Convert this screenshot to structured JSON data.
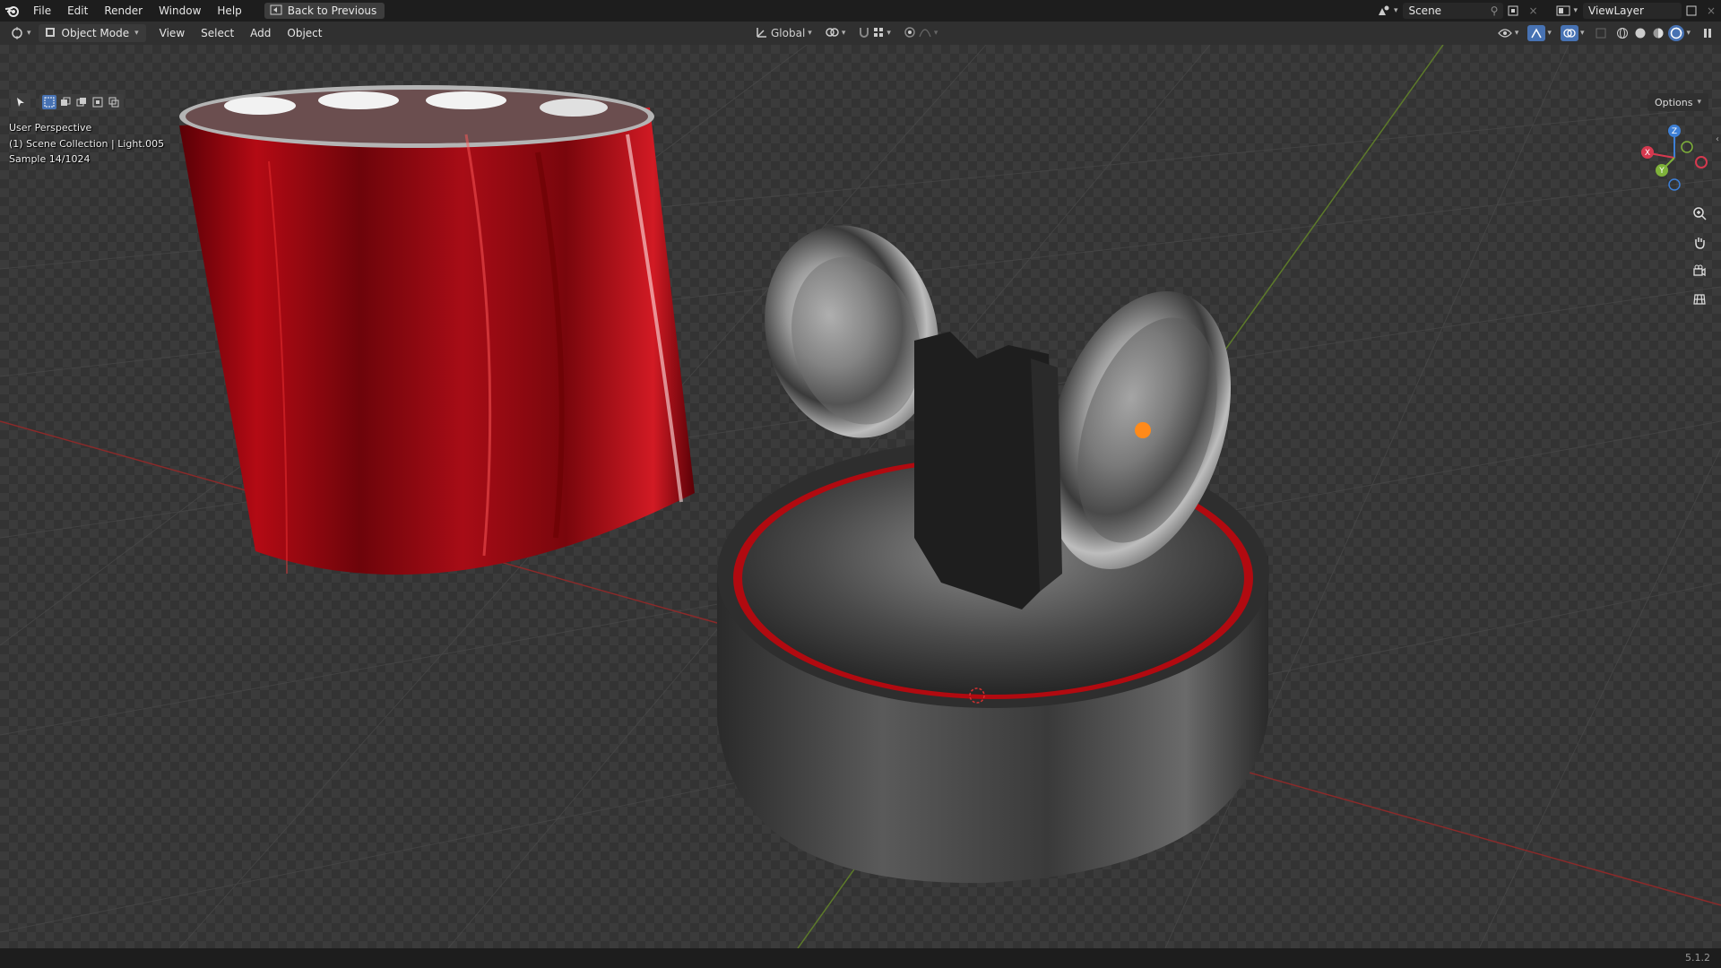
{
  "topbar": {
    "menus": [
      "File",
      "Edit",
      "Render",
      "Window",
      "Help"
    ],
    "back_button": "Back to Previous",
    "scene_name": "Scene",
    "view_layer_name": "ViewLayer"
  },
  "header": {
    "mode": "Object Mode",
    "menus": [
      "View",
      "Select",
      "Add",
      "Object"
    ],
    "transform_orientation": "Global",
    "options": "Options"
  },
  "viewport": {
    "perspective": "User Perspective",
    "collection": "(1) Scene Collection | Light.005",
    "sample": "Sample 14/1024",
    "gizmo_axes": {
      "x": "X",
      "y": "Y",
      "z": "Z"
    },
    "colors": {
      "x_axis": "#d6394f",
      "y_axis": "#7fb23a",
      "z_axis": "#3d7fd6",
      "active": "#4772b3"
    }
  },
  "statusbar": {
    "version": "5.1.2"
  },
  "icons": [
    "blender-logo-icon",
    "back-icon",
    "scene-icon",
    "pin-icon",
    "new-scene-icon",
    "view-layer-icon",
    "editor-type-icon",
    "object-mode-icon",
    "orientation-icon",
    "pivot-icon",
    "snap-icon",
    "proportional-edit-icon",
    "visibility-icon",
    "gizmo-icon",
    "overlay-icon",
    "xray-icon",
    "wireframe-icon",
    "solid-icon",
    "material-icon",
    "rendered-icon",
    "select-tool-icon",
    "zoom-icon",
    "hand-icon",
    "camera-icon",
    "grid-icon"
  ]
}
